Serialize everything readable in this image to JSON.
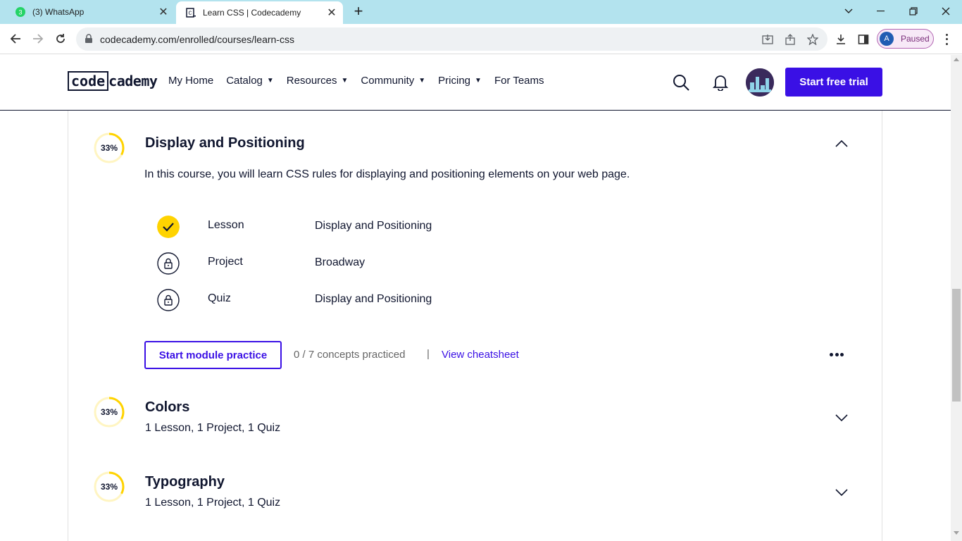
{
  "browser": {
    "tabs": [
      {
        "title": "(3) WhatsApp",
        "badge": "3",
        "favicon": "whatsapp-icon",
        "active": false
      },
      {
        "title": "Learn CSS | Codecademy",
        "favicon": "codecademy-icon",
        "active": true
      }
    ],
    "url": "codecademy.com/enrolled/courses/learn-css",
    "profile_initial": "A",
    "profile_status": "Paused"
  },
  "site": {
    "logo_box": "code",
    "logo_rest": "cademy",
    "nav": [
      {
        "label": "My Home",
        "dropdown": false
      },
      {
        "label": "Catalog",
        "dropdown": true
      },
      {
        "label": "Resources",
        "dropdown": true
      },
      {
        "label": "Community",
        "dropdown": true
      },
      {
        "label": "Pricing",
        "dropdown": true
      },
      {
        "label": "For Teams",
        "dropdown": false
      }
    ],
    "cta": "Start free trial",
    "caret": "▼"
  },
  "modules": [
    {
      "progress_label": "33%",
      "progress": 0.33,
      "title": "Display and Positioning",
      "expanded": true,
      "description": "In this course, you will learn CSS rules for displaying and positioning elements on your web page.",
      "items": [
        {
          "type": "Lesson",
          "name": "Display and Positioning",
          "status": "completed"
        },
        {
          "type": "Project",
          "name": "Broadway",
          "status": "locked"
        },
        {
          "type": "Quiz",
          "name": "Display and Positioning",
          "status": "locked"
        }
      ],
      "practice_button": "Start module practice",
      "concepts": "0 / 7 concepts practiced",
      "separator": "|",
      "cheatsheet": "View cheatsheet"
    },
    {
      "progress_label": "33%",
      "progress": 0.33,
      "title": "Colors",
      "expanded": false,
      "summary": "1 Lesson, 1 Project, 1 Quiz"
    },
    {
      "progress_label": "33%",
      "progress": 0.33,
      "title": "Typography",
      "expanded": false,
      "summary": "1 Lesson, 1 Project, 1 Quiz"
    }
  ],
  "colors": {
    "accent": "#3a10e5",
    "progress": "#ffd300",
    "ink": "#10162f"
  }
}
